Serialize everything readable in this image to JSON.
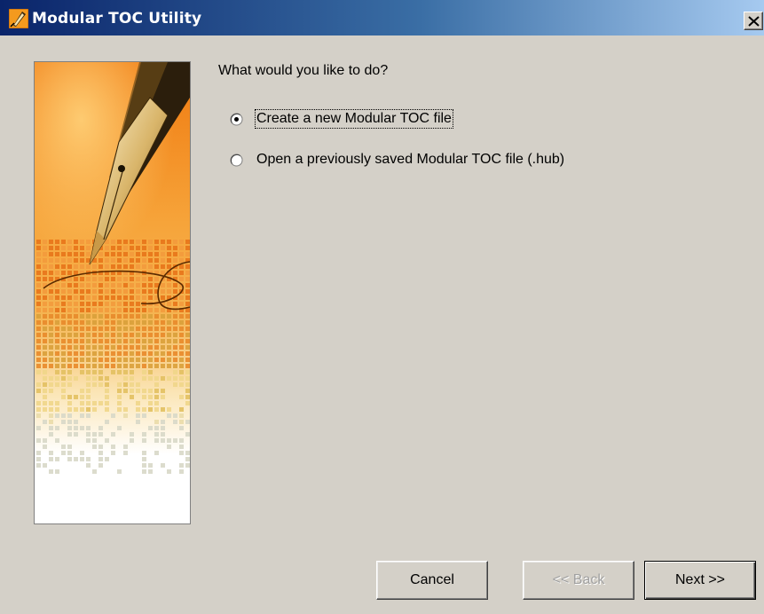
{
  "window": {
    "title": "Modular TOC Utility"
  },
  "icons": {
    "app": "pen-icon",
    "close": "close-icon"
  },
  "main": {
    "prompt": "What would you like to do?",
    "options": [
      {
        "label": "Create a new Modular TOC file",
        "selected": true
      },
      {
        "label": "Open a previously saved Modular TOC file (.hub)",
        "selected": false
      }
    ]
  },
  "buttons": {
    "cancel": "Cancel",
    "back": "<< Back",
    "next": "Next >>"
  },
  "colors": {
    "titlebar_start": "#0a246a",
    "titlebar_end": "#a6caf0",
    "dialog_background": "#d4d0c8",
    "picture_orange": "#f28a1c"
  }
}
